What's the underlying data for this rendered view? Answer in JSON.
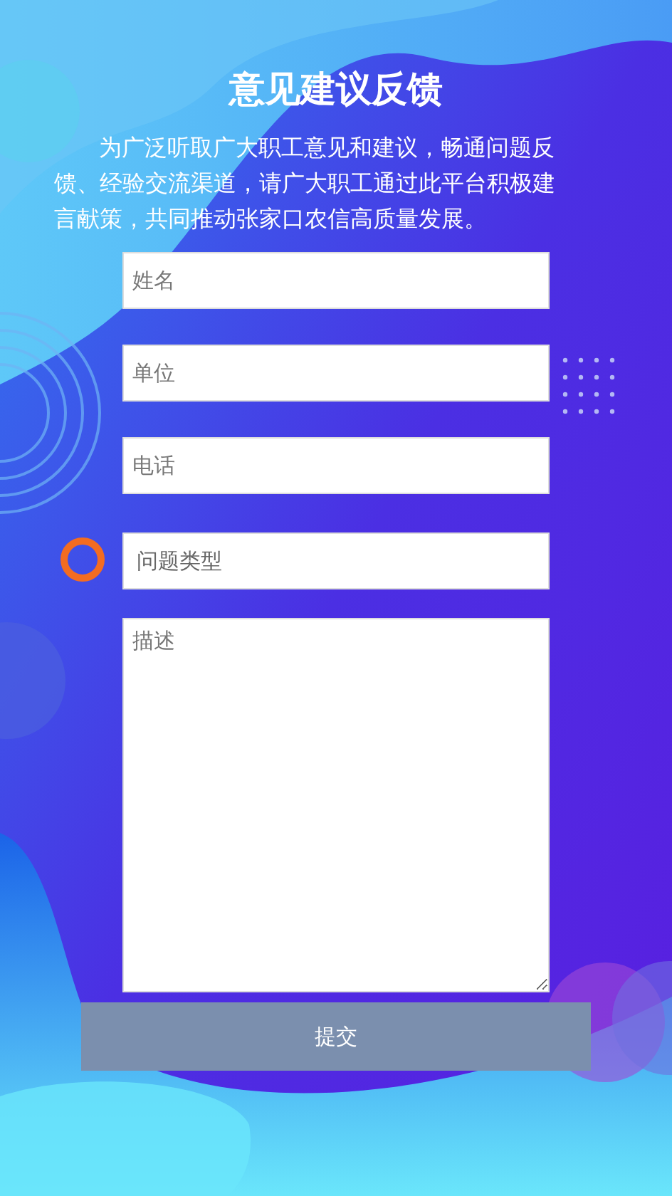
{
  "title": "意见建议反馈",
  "intro": "为广泛听取广大职工意见和建议，畅通问题反馈、经验交流渠道，请广大职工通过此平台积极建言献策，共同推动张家口农信高质量发展。",
  "fields": [
    {
      "kind": "input",
      "placeholder": "姓名"
    },
    {
      "kind": "input",
      "placeholder": "单位"
    },
    {
      "kind": "input",
      "placeholder": "电话"
    },
    {
      "kind": "select",
      "placeholder": "问题类型"
    },
    {
      "kind": "textarea",
      "placeholder": "描述"
    }
  ],
  "submit": "提交"
}
